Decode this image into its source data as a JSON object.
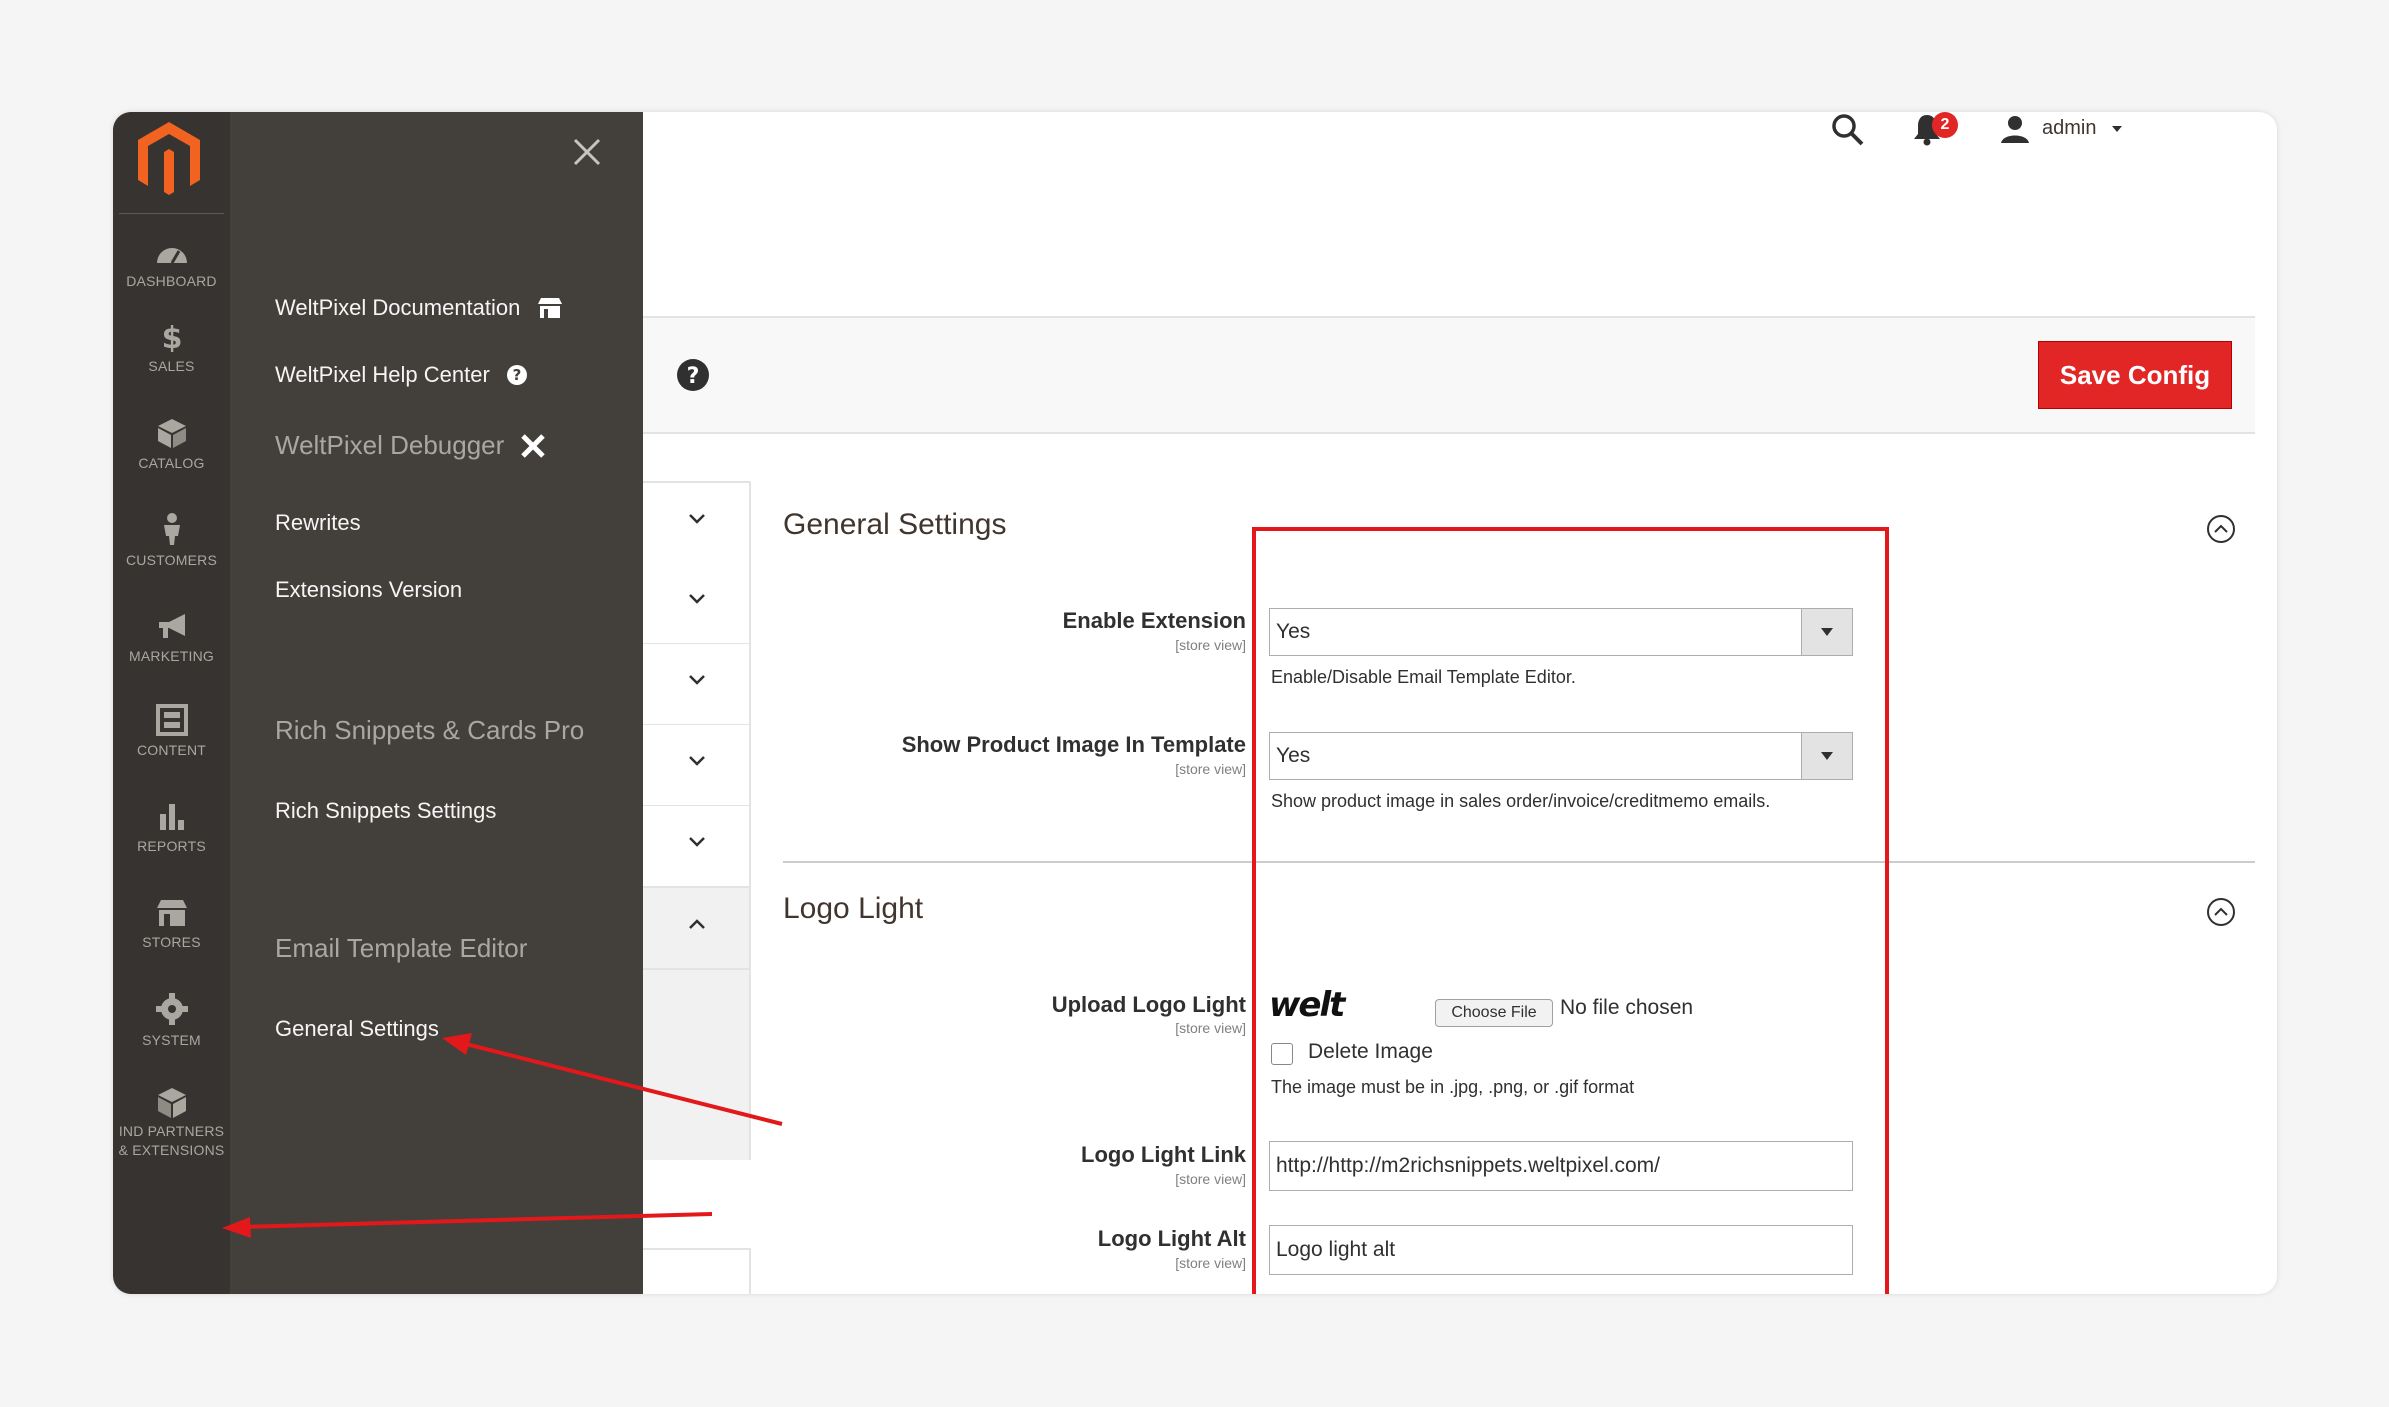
{
  "nav": {
    "items": [
      {
        "label": "DASHBOARD",
        "icon": "dashboard-icon"
      },
      {
        "label": "SALES",
        "icon": "dollar-icon"
      },
      {
        "label": "CATALOG",
        "icon": "box-icon"
      },
      {
        "label": "CUSTOMERS",
        "icon": "person-icon"
      },
      {
        "label": "MARKETING",
        "icon": "megaphone-icon"
      },
      {
        "label": "CONTENT",
        "icon": "content-icon"
      },
      {
        "label": "REPORTS",
        "icon": "bar-chart-icon"
      },
      {
        "label": "STORES",
        "icon": "store-icon"
      },
      {
        "label": "SYSTEM",
        "icon": "gear-icon"
      },
      {
        "label_line1": "IND PARTNERS",
        "label_line2": "& EXTENSIONS",
        "icon": "cube-icon"
      }
    ]
  },
  "flyout": {
    "docs_link": "WeltPixel Documentation",
    "help_link": "WeltPixel Help Center",
    "debugger_heading": "WeltPixel Debugger",
    "rewrites_link": "Rewrites",
    "extensions_link": "Extensions Version",
    "rich_heading": "Rich Snippets & Cards Pro",
    "rich_settings_link": "Rich Snippets Settings",
    "email_heading": "Email Template Editor",
    "general_link": "General Settings"
  },
  "header": {
    "notification_count": "2",
    "user": "admin"
  },
  "actions": {
    "save_label": "Save Config"
  },
  "general_section": {
    "title": "General Settings",
    "fields": [
      {
        "label": "Enable Extension",
        "scope": "[store view]",
        "value": "Yes",
        "note": "Enable/Disable Email Template Editor."
      },
      {
        "label": "Show Product Image In Template",
        "scope": "[store view]",
        "value": "Yes",
        "note": "Show product image in sales order/invoice/creditmemo emails."
      }
    ]
  },
  "logo_section": {
    "title": "Logo Light",
    "upload": {
      "label": "Upload Logo Light",
      "scope": "[store view]",
      "logo_text": "welt",
      "button": "Choose File",
      "status": "No file chosen",
      "delete_label": "Delete Image",
      "note": "The image must be in .jpg, .png, or .gif format"
    },
    "link": {
      "label": "Logo Light Link",
      "scope": "[store view]",
      "value": "http://http://m2richsnippets.weltpixel.com/"
    },
    "alt": {
      "label": "Logo Light Alt",
      "scope": "[store view]",
      "value": "Logo light alt"
    }
  },
  "colors": {
    "accent": "#e22626",
    "rail": "#373330",
    "flyout": "#433f3b",
    "annotation": "#e3181a"
  }
}
